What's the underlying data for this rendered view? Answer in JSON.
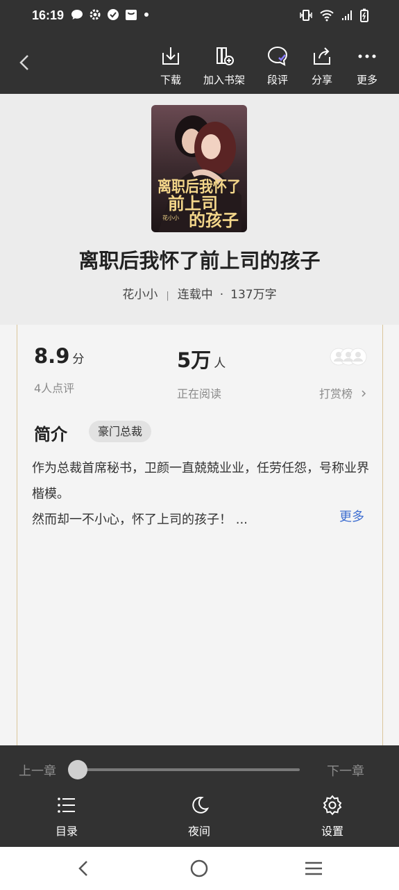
{
  "status_bar": {
    "time": "16:19"
  },
  "toolbar": {
    "download": "下载",
    "add_shelf": "加入书架",
    "comments": "段评",
    "share": "分享",
    "more": "更多"
  },
  "book": {
    "title": "离职后我怀了前上司的孩子",
    "author": "花小小",
    "status": "连载中",
    "word_count": "137万字",
    "cover": {
      "title_line1": "离职后我怀了",
      "title_line2": "前上司",
      "title_line3": "的孩子",
      "author": "花小小"
    }
  },
  "stats": {
    "score": "8.9",
    "score_unit": "分",
    "score_sub": "4人点评",
    "readers": "5万",
    "readers_unit": "人",
    "readers_sub": "正在阅读",
    "reward_label": "打赏榜"
  },
  "intro": {
    "heading": "简介",
    "tag": "豪门总裁",
    "line1": "作为总裁首席秘书，卫颜一直兢兢业业，任劳任怨，号称业界楷模。",
    "line2": "然而却一不小心，怀了上司的孩子！ ...",
    "more": "更多"
  },
  "reader_bar": {
    "prev": "上一章",
    "next": "下一章",
    "progress": 0,
    "toc": "目录",
    "night": "夜间",
    "settings": "设置"
  },
  "colors": {
    "bar_bg": "#323232",
    "page_bg": "#f4f4f4",
    "accent_link": "#3f6fd1"
  }
}
